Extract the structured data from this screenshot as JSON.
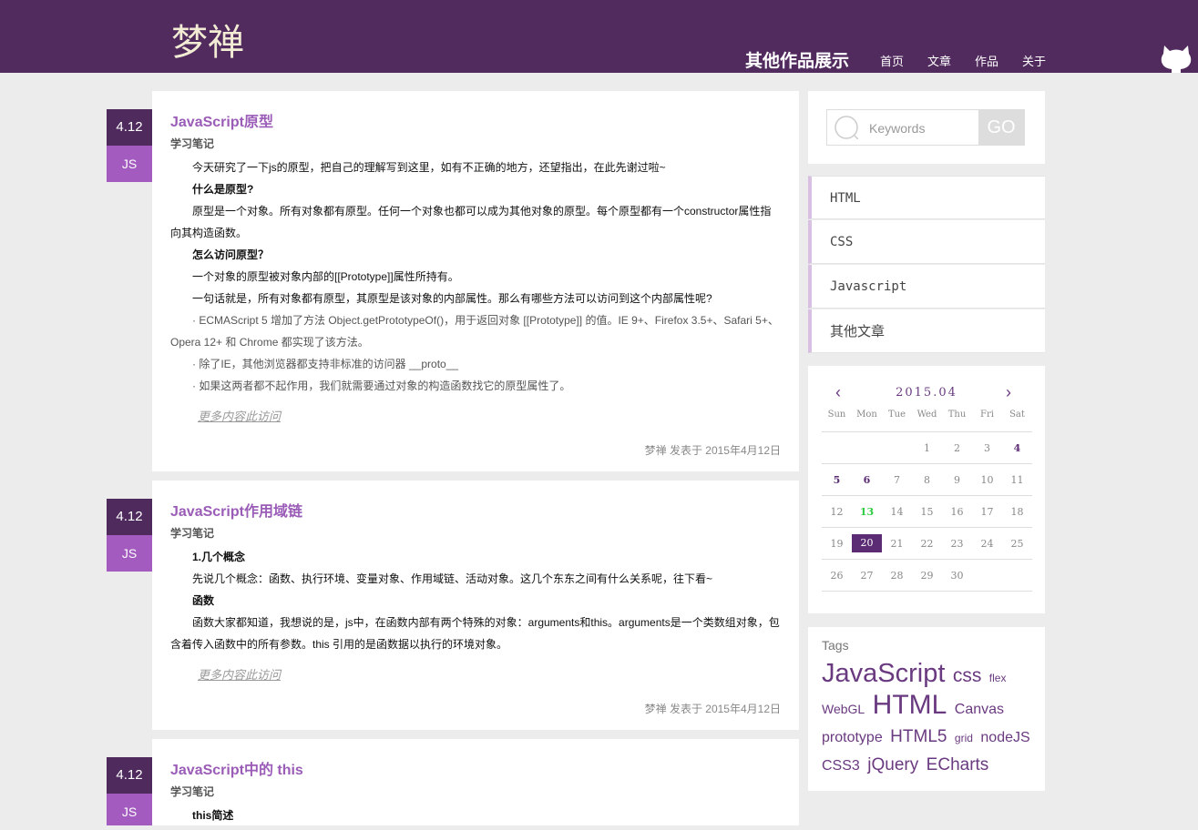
{
  "header": {
    "logo_text": "梦禅",
    "brand": "其他作品展示",
    "nav": [
      "首页",
      "文章",
      "作品",
      "关于"
    ],
    "github_icon": "github-icon",
    "bg_color": "#512a5e"
  },
  "posts": [
    {
      "date": "4.12",
      "tag": "JS",
      "title": "JavaScript原型",
      "category": "学习笔记",
      "paragraphs": [
        "今天研究了一下js的原型，把自己的理解写到这里，如有不正确的地方，还望指出，在此先谢过啦~",
        "什么是原型?",
        "原型是一个对象。所有对象都有原型。任何一个对象也都可以成为其他对象的原型。每个原型都有一个constructor属性指向其构造函数。",
        "怎么访问原型？",
        "一个对象的原型被对象内部的[[Prototype]]属性所持有。",
        "一句话就是，所有对象都有原型，其原型是该对象的内部属性。那么有哪些方法可以访问到这个内部属性呢?",
        "· ECMAScript 5 增加了方法 Object.getPrototypeOf()，用于返回对象 [[Prototype]] 的值。IE 9+、Firefox 3.5+、Safari 5+、Opera 12+ 和 Chrome 都实现了该方法。",
        "· 除了IE，其他浏览器都支持非标准的访问器 __proto__",
        "· 如果这两者都不起作用，我们就需要通过对象的构造函数找它的原型属性了。"
      ],
      "more": "更多内容此访问",
      "meta": "梦禅 发表于 2015年4月12日"
    },
    {
      "date": "4.12",
      "tag": "JS",
      "title": "JavaScript作用域链",
      "category": "学习笔记",
      "paragraphs": [
        "1.几个概念",
        "先说几个概念：函数、执行环境、变量对象、作用域链、活动对象。这几个东东之间有什么关系呢，往下看~",
        "函数",
        "函数大家都知道，我想说的是，js中，在函数内部有两个特殊的对象：arguments和this。arguments是一个类数组对象，包含着传入函数中的所有参数。this 引用的是函数据以执行的环境对象。"
      ],
      "more": "更多内容此访问",
      "meta": "梦禅 发表于 2015年4月12日"
    },
    {
      "date": "4.12",
      "tag": "JS",
      "title": "JavaScript中的 this",
      "category": "学习笔记",
      "paragraphs": [
        "this简述"
      ]
    }
  ],
  "sidebar": {
    "search": {
      "placeholder": "Keywords",
      "button": "GO"
    },
    "categories": [
      "HTML",
      "CSS",
      "Javascript",
      "其他文章"
    ],
    "calendar": {
      "title": "2015.04",
      "prev": "‹",
      "next": "›",
      "dow": [
        "Sun",
        "Mon",
        "Tue",
        "Wed",
        "Thu",
        "Fri",
        "Sat"
      ],
      "weeks": [
        [
          "",
          "",
          "",
          "1",
          "2",
          "3",
          "4"
        ],
        [
          "5",
          "6",
          "7",
          "8",
          "9",
          "10",
          "11"
        ],
        [
          "12",
          "13",
          "14",
          "15",
          "16",
          "17",
          "18"
        ],
        [
          "19",
          "20",
          "21",
          "22",
          "23",
          "24",
          "25"
        ],
        [
          "26",
          "27",
          "28",
          "29",
          "30",
          "",
          ""
        ]
      ],
      "bold_days": [
        "4",
        "5",
        "6"
      ],
      "today": "13",
      "selected": "20"
    },
    "tags": {
      "title": "Tags",
      "items": [
        "JavaScript",
        "css",
        "flex",
        "WebGL",
        "HTML",
        "Canvas",
        "prototype",
        "HTML5",
        "grid",
        "nodeJS",
        "CSS3",
        "jQuery",
        "ECharts"
      ]
    }
  }
}
